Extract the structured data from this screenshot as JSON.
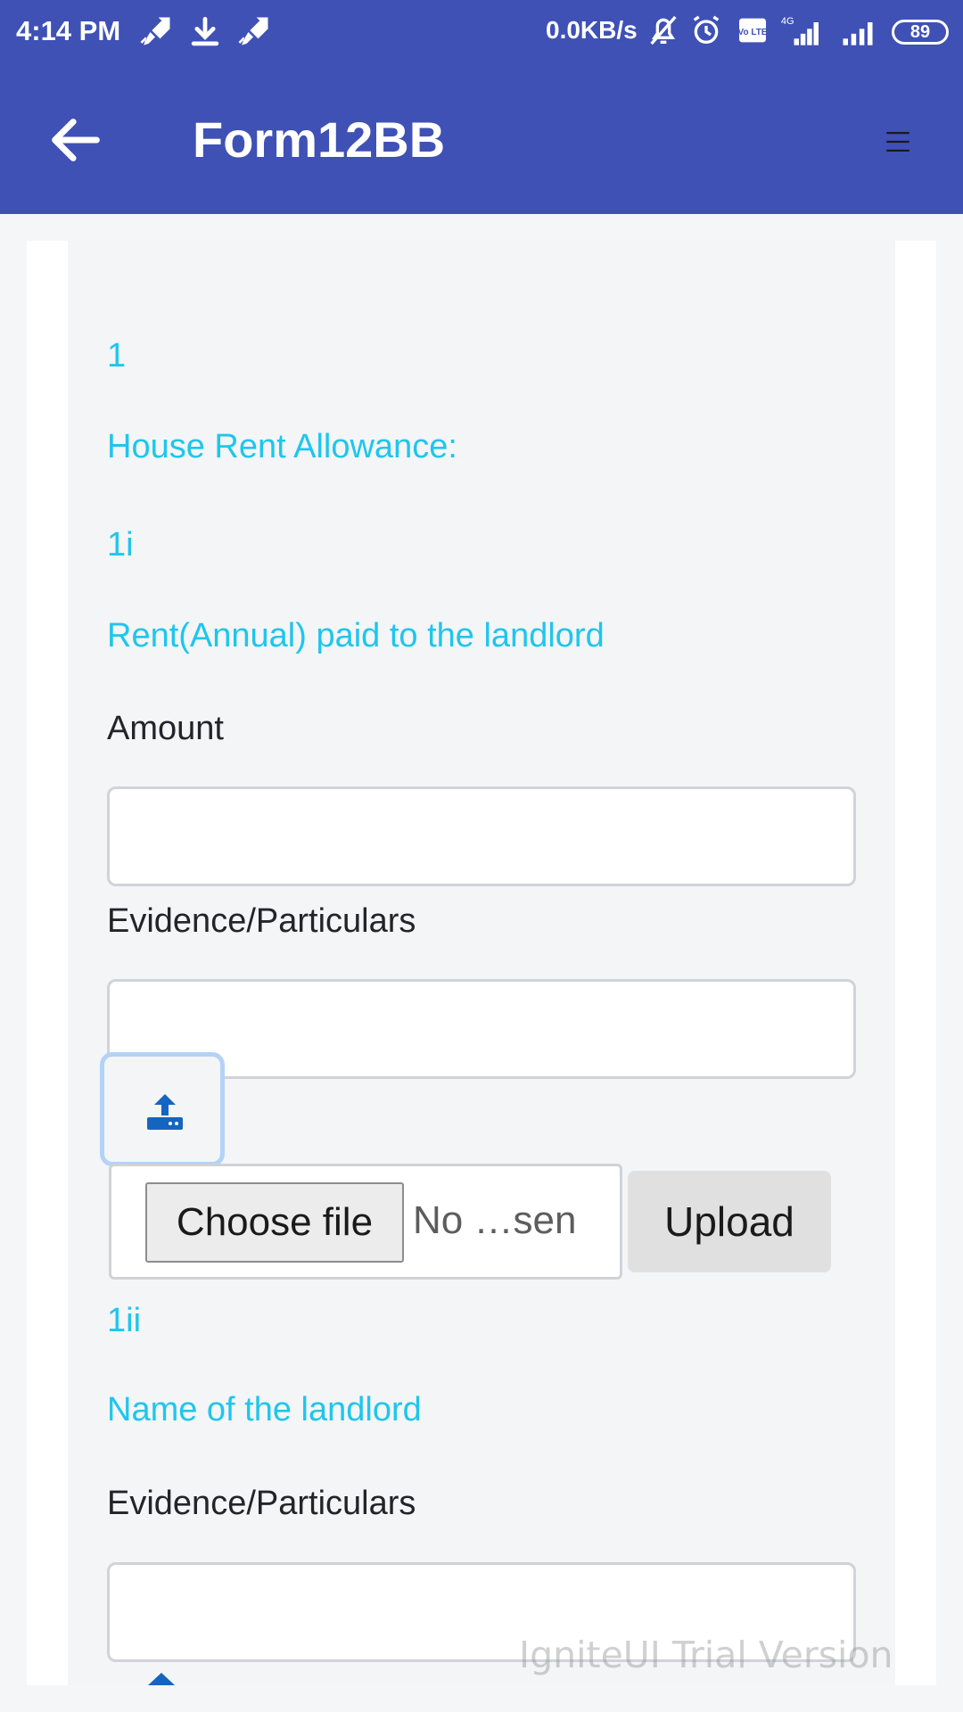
{
  "status_bar": {
    "time": "4:14 PM",
    "network_speed": "0.0KB/s",
    "battery_level": "89",
    "network_type": "4G",
    "volte_label": "Vo LTE",
    "icons": [
      "rocket-icon",
      "download-icon",
      "rocket-icon",
      "bell-off-icon",
      "alarm-icon",
      "volte-icon",
      "signal-4g-icon",
      "signal-icon",
      "battery-icon"
    ]
  },
  "app_bar": {
    "title": "Form12BB",
    "back_icon": "arrow-left-icon",
    "menu_icon": "hamburger-icon",
    "color": "#3f51b5"
  },
  "form": {
    "section_number": "1",
    "section_title": "House Rent Allowance:",
    "item_1i": {
      "number": "1i",
      "title": "Rent(Annual) paid to the landlord",
      "amount_label": "Amount",
      "amount_value": "",
      "evidence_label": "Evidence/Particulars",
      "evidence_value": "",
      "choose_file_label": "Choose file",
      "file_status": "No …sen",
      "upload_label": "Upload"
    },
    "item_1ii": {
      "number": "1ii",
      "title": "Name of the landlord",
      "evidence_label": "Evidence/Particulars",
      "evidence_value": ""
    }
  },
  "watermark": "IgniteUI Trial Version",
  "colors": {
    "accent_cyan": "#1ec6ec",
    "upload_icon": "#1565c0",
    "focus_ring": "#b3d2f7"
  }
}
